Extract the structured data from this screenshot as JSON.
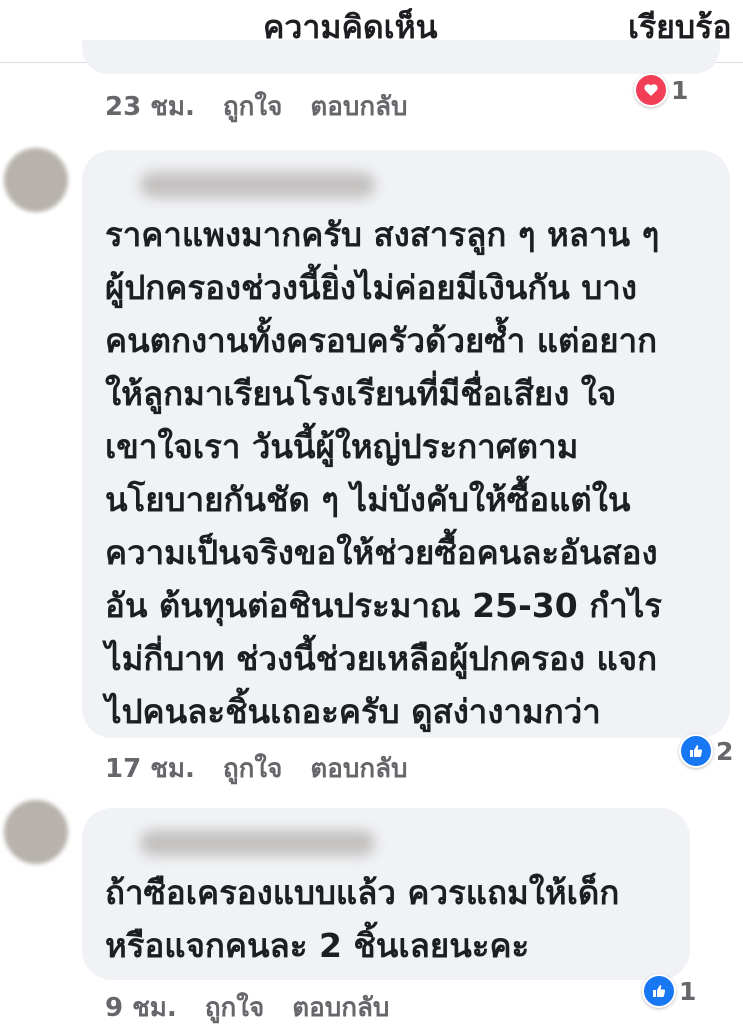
{
  "header": {
    "title": "ความคิดเห็น",
    "sort_label": "เรียบร้อ"
  },
  "comments": [
    {
      "time": "23 ชม.",
      "like_label": "ถูกใจ",
      "reply_label": "ตอบกลับ",
      "reaction": {
        "icon": "heart-icon",
        "count": "1",
        "color": "#f33e58"
      }
    },
    {
      "lines": [
        "ราคาแพงมากครับ สงสารลูก ๆ หลาน ๆ",
        "ผู้ปกครองช่วงนี้ยิ่งไม่ค่อยมีเงินกัน บาง",
        "คนตกงานทั้งครอบครัวด้วยซ้ำ แต่อยาก",
        "ให้ลูกมาเรียนโรงเรียนที่มีชื่อเสียง ใจ",
        "เขาใจเรา วันนี้ผู้ใหญ่ประกาศตาม",
        "นโยบายกันชัด ๆ ไม่บังคับให้ซื้อแต่ใน",
        "ความเป็นจริงขอให้ช่วยซื้อคนละอันสอง",
        "อัน ต้นทุนต่อชินประมาณ 25-30 กำไร",
        "ไม่กี่บาท ช่วงนี้ช่วยเหลือผู้ปกครอง แจก",
        "ไปคนละชิ้นเถอะครับ ดูสง่างามกว่า"
      ],
      "time": "17 ชม.",
      "like_label": "ถูกใจ",
      "reply_label": "ตอบกลับ",
      "reaction": {
        "icon": "like-icon",
        "count": "2",
        "color": "#1877f2"
      }
    },
    {
      "lines": [
        "ถ้าซือเครองแบบแล้ว ควรแถมให้เด็ก",
        "หรือแจกคนละ 2 ชิ้นเลยนะคะ"
      ],
      "time": "9 ชม.",
      "like_label": "ถูกใจ",
      "reply_label": "ตอบกลับ",
      "reaction": {
        "icon": "like-icon",
        "count": "1",
        "color": "#1877f2"
      }
    }
  ]
}
